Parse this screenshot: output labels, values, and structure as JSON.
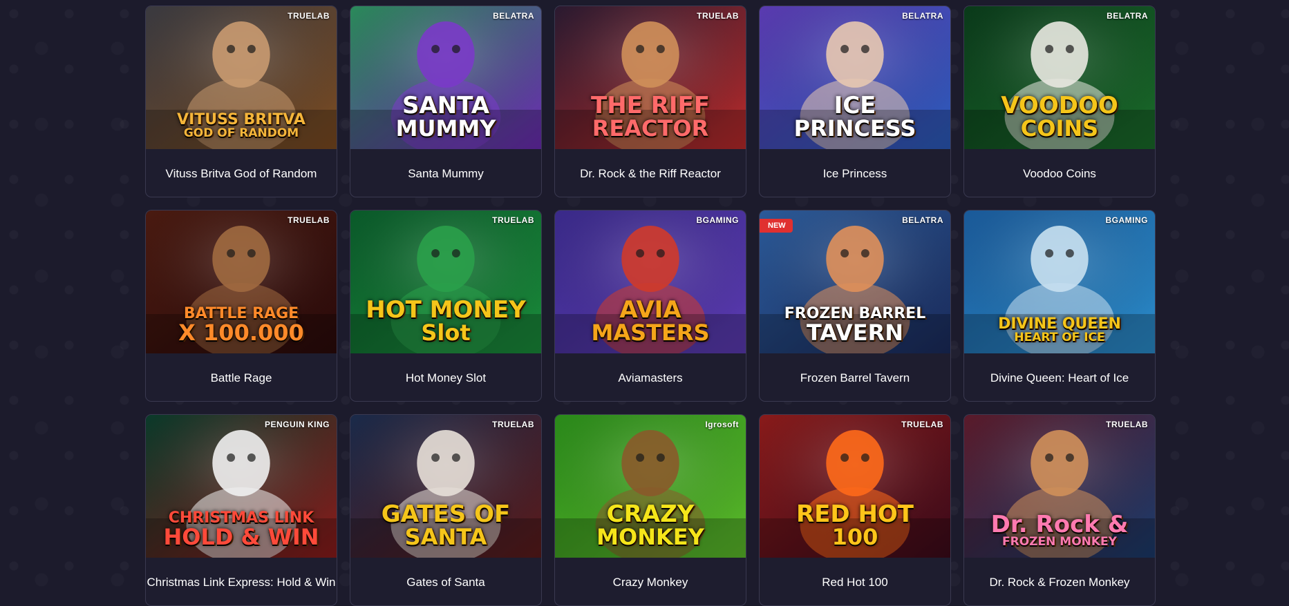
{
  "games": [
    {
      "title": "Vituss Britva God of Random",
      "provider": "TRUELAB",
      "logo1": "VITUSS BRITVA",
      "logo2": "GOD OF RANDOM",
      "bg1": "#3a3a40",
      "bg2": "#7a4a20",
      "logoColor": "#f5b53a",
      "figure": "#c99a70",
      "new": false
    },
    {
      "title": "Santa Mummy",
      "provider": "BELATRA",
      "logo1": "SANTA",
      "logo2": "MUMMY",
      "bg1": "#2a8a5a",
      "bg2": "#6a2ab0",
      "logoColor": "#ffffff",
      "figure": "#7a3ac8",
      "new": false
    },
    {
      "title": "Dr. Rock & the Riff Reactor",
      "provider": "TRUELAB",
      "logo1": "THE RIFF",
      "logo2": "REACTOR",
      "bg1": "#2a1a30",
      "bg2": "#b82a2a",
      "logoColor": "#ff6a6a",
      "figure": "#d0905a",
      "new": false
    },
    {
      "title": "Ice Princess",
      "provider": "BELATRA",
      "logo1": "ICE",
      "logo2": "PRINCESS",
      "bg1": "#5a3ab0",
      "bg2": "#2a5ab8",
      "logoColor": "#ffffff",
      "figure": "#e8c8b0",
      "new": false
    },
    {
      "title": "Voodoo Coins",
      "provider": "BELATRA",
      "logo1": "VOODOO",
      "logo2": "COINS",
      "bg1": "#0a3a1a",
      "bg2": "#1a6a2a",
      "logoColor": "#f5c51a",
      "figure": "#e8e8e0",
      "new": false
    },
    {
      "title": "Battle Rage",
      "provider": "TRUELAB",
      "logo1": "BATTLE RAGE",
      "logo2": "X 100.000",
      "bg1": "#4a1a10",
      "bg2": "#2a0a0a",
      "logoColor": "#ff8a2a",
      "figure": "#a06a40",
      "new": false
    },
    {
      "title": "Hot Money Slot",
      "provider": "TRUELAB",
      "logo1": "HOT MONEY",
      "logo2": "Slot",
      "bg1": "#0a5a2a",
      "bg2": "#1a8a3a",
      "logoColor": "#f5c51a",
      "figure": "#2aa04a",
      "new": false
    },
    {
      "title": "Aviamasters",
      "provider": "BGAMING",
      "logo1": "AVIA",
      "logo2": "MASTERS",
      "bg1": "#3a2a8a",
      "bg2": "#5a3ab0",
      "logoColor": "#f5a51a",
      "figure": "#d03a2a",
      "new": false
    },
    {
      "title": "Frozen Barrel Tavern",
      "provider": "BELATRA",
      "logo1": "FROZEN BARREL",
      "logo2": "TAVERN",
      "bg1": "#2a5a9a",
      "bg2": "#1a2a5a",
      "logoColor": "#ffffff",
      "figure": "#e0905a",
      "new": true,
      "newLabel": "NEW"
    },
    {
      "title": "Divine Queen: Heart of Ice",
      "provider": "BGAMING",
      "logo1": "DIVINE QUEEN",
      "logo2": "HEART OF ICE",
      "bg1": "#1a5a9a",
      "bg2": "#2a8ac8",
      "logoColor": "#f5c51a",
      "figure": "#c8e0f0",
      "new": false
    },
    {
      "title": "Christmas Link Express: Hold & Win",
      "provider": "PENGUIN KING",
      "logo1": "CHRISTMAS LINK",
      "logo2": "HOLD & WIN",
      "bg1": "#0a3a2a",
      "bg2": "#8a1a1a",
      "logoColor": "#ff4a3a",
      "figure": "#f0f0f0",
      "new": false
    },
    {
      "title": "Gates of Santa",
      "provider": "TRUELAB",
      "logo1": "GATES OF",
      "logo2": "SANTA",
      "bg1": "#1a2a4a",
      "bg2": "#5a1a1a",
      "logoColor": "#f5c51a",
      "figure": "#e8e0d8",
      "new": false
    },
    {
      "title": "Crazy Monkey",
      "provider": "Igrosoft",
      "logo1": "CRAZY",
      "logo2": "MONKEY",
      "bg1": "#2a8a1a",
      "bg2": "#5ab82a",
      "logoColor": "#f5e51a",
      "figure": "#8a5a2a",
      "new": false
    },
    {
      "title": "Red Hot 100",
      "provider": "TRUELAB",
      "logo1": "RED HOT",
      "logo2": "100",
      "bg1": "#8a1a1a",
      "bg2": "#3a0a1a",
      "logoColor": "#ffc51a",
      "figure": "#ff6a1a",
      "new": false
    },
    {
      "title": "Dr. Rock & Frozen Monkey",
      "provider": "TRUELAB",
      "logo1": "Dr. Rock &",
      "logo2": "FROZEN MONKEY",
      "bg1": "#5a1a2a",
      "bg2": "#1a3a6a",
      "logoColor": "#ff7ab0",
      "figure": "#d0905a",
      "new": false
    }
  ]
}
